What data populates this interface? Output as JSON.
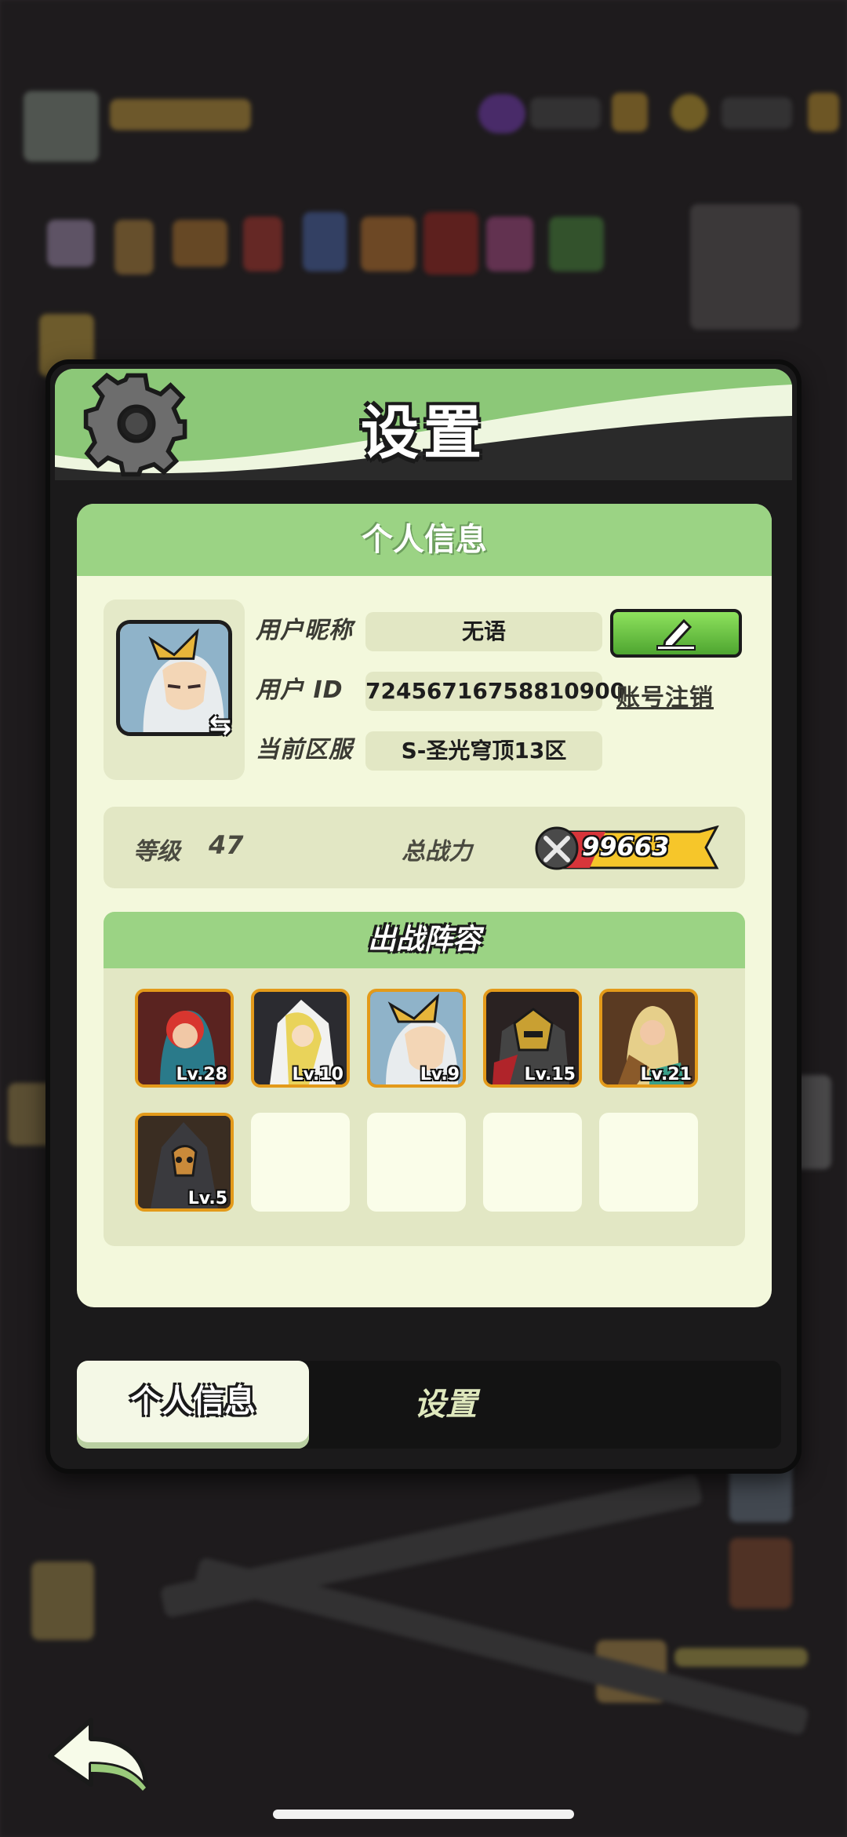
{
  "dialog": {
    "title": "设置"
  },
  "personal_info": {
    "section_title": "个人信息",
    "nickname_label": "用户昵称",
    "nickname_value": "无语",
    "id_label": "用户  ID",
    "id_value": "72456716758810900",
    "cancel_account_label": "账号注销",
    "server_label": "当前区服",
    "server_value": "S-圣光穹顶13区"
  },
  "stats": {
    "level_label": "等级",
    "level_value": "47",
    "power_label": "总战力",
    "power_value": "99663"
  },
  "lineup": {
    "title": "出战阵容",
    "heroes": [
      {
        "level": "Lv.28"
      },
      {
        "level": "Lv.10"
      },
      {
        "level": "Lv.9"
      },
      {
        "level": "Lv.15"
      },
      {
        "level": "Lv.21"
      },
      {
        "level": "Lv.5"
      }
    ]
  },
  "tabs": {
    "active": "个人信息",
    "inactive": "设置"
  },
  "colors": {
    "header_green": "#8cc878",
    "panel_bg": "#f3f8dc",
    "edit_green": "#6cc444",
    "hero_border": "#e39a1a",
    "power_yellow": "#f6c62a"
  }
}
